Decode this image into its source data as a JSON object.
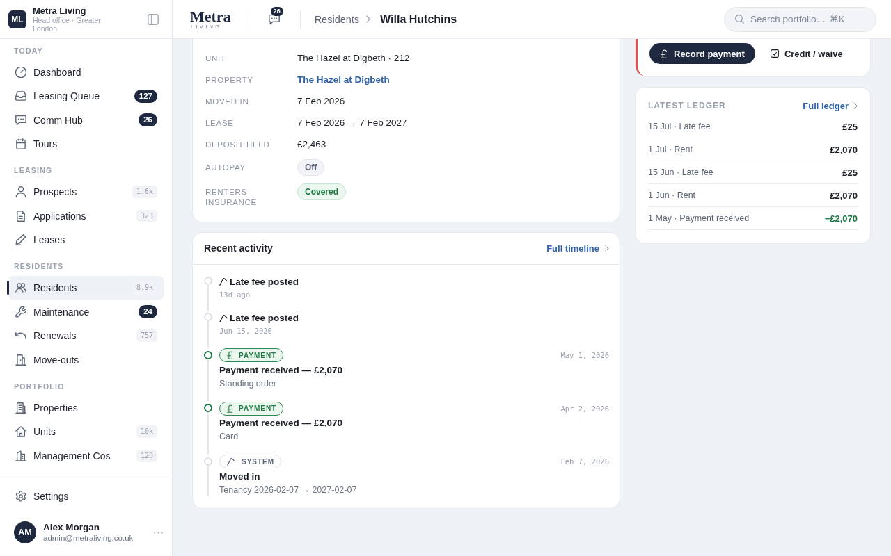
{
  "sidebar": {
    "brand": {
      "initials": "ML",
      "name": "Metra Living",
      "subtitle": "Head office · Greater London"
    },
    "sections": [
      {
        "label": "TODAY",
        "items": [
          {
            "label": "Dashboard",
            "selected": false
          },
          {
            "label": "Leasing Queue",
            "badge": {
              "text": "127",
              "kind": "strong"
            },
            "selected": false
          },
          {
            "label": "Comm Hub",
            "badge": {
              "text": "26",
              "kind": "strong"
            },
            "selected": false
          },
          {
            "label": "Tours",
            "selected": false
          }
        ]
      },
      {
        "label": "LEASING",
        "items": [
          {
            "label": "Prospects",
            "badge": {
              "text": "1.6k",
              "kind": "muted"
            },
            "selected": false
          },
          {
            "label": "Applications",
            "badge": {
              "text": "323",
              "kind": "muted"
            },
            "selected": false
          },
          {
            "label": "Leases",
            "selected": false
          }
        ]
      },
      {
        "label": "RESIDENTS",
        "items": [
          {
            "label": "Residents",
            "badge": {
              "text": "8.9k",
              "kind": "muted"
            },
            "selected": true
          },
          {
            "label": "Maintenance",
            "badge": {
              "text": "24",
              "kind": "strong"
            },
            "selected": false
          },
          {
            "label": "Renewals",
            "badge": {
              "text": "757",
              "kind": "muted"
            },
            "selected": false
          },
          {
            "label": "Move-outs",
            "selected": false
          }
        ]
      },
      {
        "label": "PORTFOLIO",
        "items": [
          {
            "label": "Properties",
            "selected": false
          },
          {
            "label": "Units",
            "badge": {
              "text": "10k",
              "kind": "muted"
            },
            "selected": false
          },
          {
            "label": "Management Cos",
            "badge": {
              "text": "120",
              "kind": "muted"
            },
            "selected": false
          }
        ]
      }
    ],
    "settings": {
      "label": "Settings"
    },
    "user": {
      "initials": "AM",
      "name": "Alex Morgan",
      "email": "admin@metraliving.co.uk"
    }
  },
  "header": {
    "logo": {
      "wordmark": "Metra",
      "tagline": "LIVING"
    },
    "messages": {
      "count": "26"
    },
    "breadcrumb": {
      "parent": "Residents",
      "current": "Willa Hutchins"
    },
    "search": {
      "placeholder": "Search portfolio…",
      "shortcut": "⌘K"
    }
  },
  "details": [
    {
      "label": "UNIT",
      "value": "The Hazel at Digbeth · 212",
      "kind": "text"
    },
    {
      "label": "PROPERTY",
      "value": "The Hazel at Digbeth",
      "kind": "link"
    },
    {
      "label": "MOVED IN",
      "value": "7 Feb 2026",
      "kind": "text"
    },
    {
      "label": "LEASE",
      "value": "7 Feb 2026 → 7 Feb 2027",
      "kind": "text"
    },
    {
      "label": "DEPOSIT HELD",
      "value": "£2,463",
      "kind": "text"
    },
    {
      "label": "AUTOPAY",
      "value": "Off",
      "kind": "pill",
      "active": false
    },
    {
      "label": "RENTERS INSURANCE",
      "value": "Covered",
      "kind": "pill",
      "active": true
    }
  ],
  "activity": {
    "title": "Recent activity",
    "link": "Full timeline",
    "items": [
      {
        "kind": "note",
        "title": "Late fee posted",
        "time": "13d ago"
      },
      {
        "kind": "note",
        "title": "Late fee posted",
        "time": "Jun 15, 2026"
      },
      {
        "kind": "payment",
        "tag": "PAYMENT",
        "date": "May 1, 2026",
        "title": "Payment received — £2,070",
        "detail": "Standing order"
      },
      {
        "kind": "payment",
        "tag": "PAYMENT",
        "date": "Apr 2, 2026",
        "title": "Payment received — £2,070",
        "detail": "Card"
      },
      {
        "kind": "system",
        "tag": "SYSTEM",
        "date": "Feb 7, 2026",
        "title": "Moved in",
        "detail": "Tenancy 2026-02-07 → 2027-02-07"
      }
    ]
  },
  "alert": {
    "urgent": true,
    "actions": [
      {
        "label": "Record payment",
        "kind": "primary"
      },
      {
        "label": "Credit / waive",
        "kind": "secondary"
      }
    ]
  },
  "ledger": {
    "title": "LATEST LEDGER",
    "link": "Full ledger",
    "rows": [
      {
        "label": "15 Jul · Late fee",
        "amount": "£25",
        "kind": "charge"
      },
      {
        "label": "1 Jul · Rent",
        "amount": "£2,070",
        "kind": "charge"
      },
      {
        "label": "15 Jun · Late fee",
        "amount": "£25",
        "kind": "charge"
      },
      {
        "label": "1 Jun · Rent",
        "amount": "£2,070",
        "kind": "charge"
      },
      {
        "label": "1 May · Payment received",
        "amount": "−£2,070",
        "kind": "credit"
      }
    ]
  }
}
